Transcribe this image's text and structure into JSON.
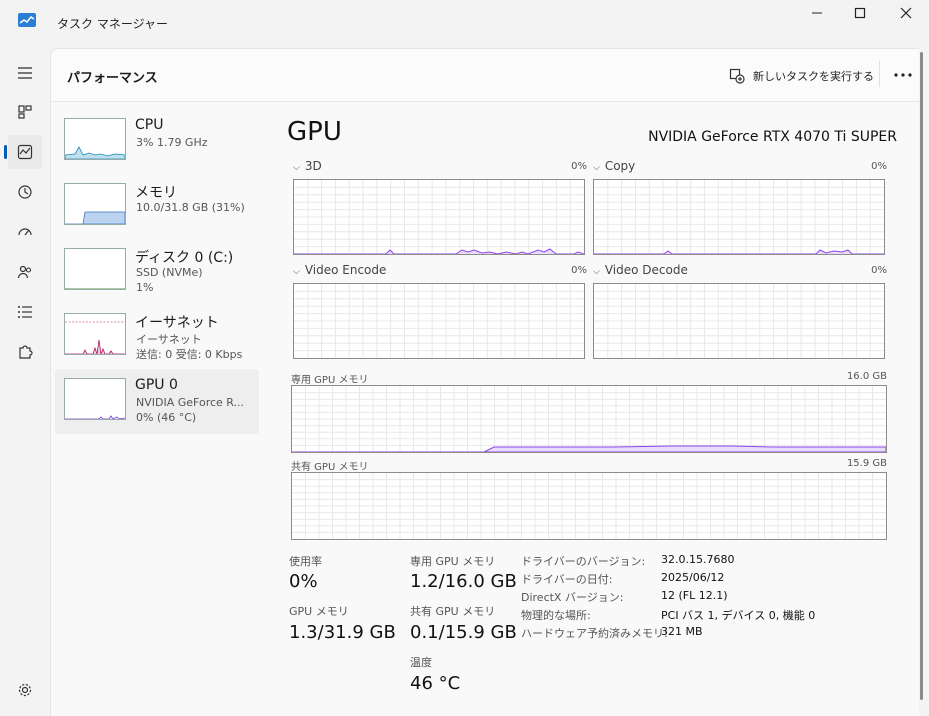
{
  "window": {
    "title": "タスク マネージャー"
  },
  "header": {
    "title": "パフォーマンス",
    "run_new_task": "新しいタスクを実行する"
  },
  "nav": {
    "items": [
      "menu",
      "processes",
      "performance",
      "app-history",
      "startup-apps",
      "users",
      "details",
      "services"
    ],
    "selected": "performance",
    "settings": "settings"
  },
  "devices": [
    {
      "name": "CPU",
      "line1": "3%  1.79 GHz",
      "line2": "",
      "line3": "",
      "accent": "#1a8ab5"
    },
    {
      "name": "メモリ",
      "line1": "10.0/31.8 GB (31%)",
      "line2": "",
      "line3": "",
      "accent": "#3c78c2"
    },
    {
      "name": "ディスク 0 (C:)",
      "line1": "SSD (NVMe)",
      "line2": "1%",
      "line3": "",
      "accent": "#4a9b3d"
    },
    {
      "name": "イーサネット",
      "line1": "イーサネット",
      "line2": "送信: 0  受信: 0 Kbps",
      "line3": "",
      "accent": "#b5155e"
    },
    {
      "name": "GPU 0",
      "line1": "NVIDIA GeForce R...",
      "line2": "0%  (46 °C)",
      "line3": "",
      "accent": "#7a3fd6"
    }
  ],
  "gpu": {
    "title": "GPU",
    "model": "NVIDIA GeForce RTX 4070 Ti SUPER",
    "accent": "#8e44ec",
    "engines": [
      {
        "label": "3D",
        "pct": "0%"
      },
      {
        "label": "Copy",
        "pct": "0%"
      },
      {
        "label": "Video Encode",
        "pct": "0%"
      },
      {
        "label": "Video Decode",
        "pct": "0%"
      }
    ],
    "dedicated": {
      "label": "専用 GPU メモリ",
      "max": "16.0 GB"
    },
    "shared": {
      "label": "共有 GPU メモリ",
      "max": "15.9 GB"
    },
    "stats": {
      "usage_label": "使用率",
      "usage_value": "0%",
      "gpu_mem_label": "GPU メモリ",
      "gpu_mem_value": "1.3/31.9 GB",
      "ded_label": "専用 GPU メモリ",
      "ded_value": "1.2/16.0 GB",
      "shared_label": "共有 GPU メモリ",
      "shared_value": "0.1/15.9 GB",
      "temp_label": "温度",
      "temp_value": "46 °C"
    },
    "info": [
      {
        "key": "ドライバーのバージョン:",
        "value": "32.0.15.7680"
      },
      {
        "key": "ドライバーの日付:",
        "value": "2025/06/12"
      },
      {
        "key": "DirectX バージョン:",
        "value": "12 (FL 12.1)"
      },
      {
        "key": "物理的な場所:",
        "value": "PCI バス 1, デバイス 0, 機能 0"
      },
      {
        "key": "ハードウェア予約済みメモリ:",
        "value": "321 MB"
      }
    ]
  }
}
